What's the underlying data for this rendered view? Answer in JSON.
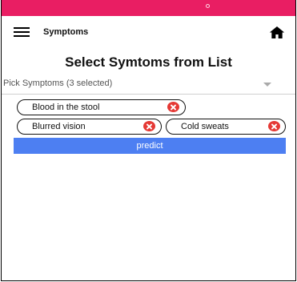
{
  "colors": {
    "status_bar": "#e91e63",
    "accent": "#4d7ff2",
    "remove": "#e53935"
  },
  "appbar": {
    "menu_icon": "hamburger-menu-icon",
    "title": "Symptoms",
    "home_icon": "home-icon"
  },
  "page": {
    "title": "Select Symtoms from List"
  },
  "picker": {
    "label": "Pick Symptoms (3 selected)",
    "dropdown_icon": "caret-down-icon"
  },
  "chips": [
    {
      "label": "Blood in the stool",
      "remove_icon": "close-circle-icon"
    },
    {
      "label": "Blurred vision",
      "remove_icon": "close-circle-icon"
    },
    {
      "label": "Cold sweats",
      "remove_icon": "close-circle-icon"
    }
  ],
  "actions": {
    "predict_label": "predict"
  }
}
